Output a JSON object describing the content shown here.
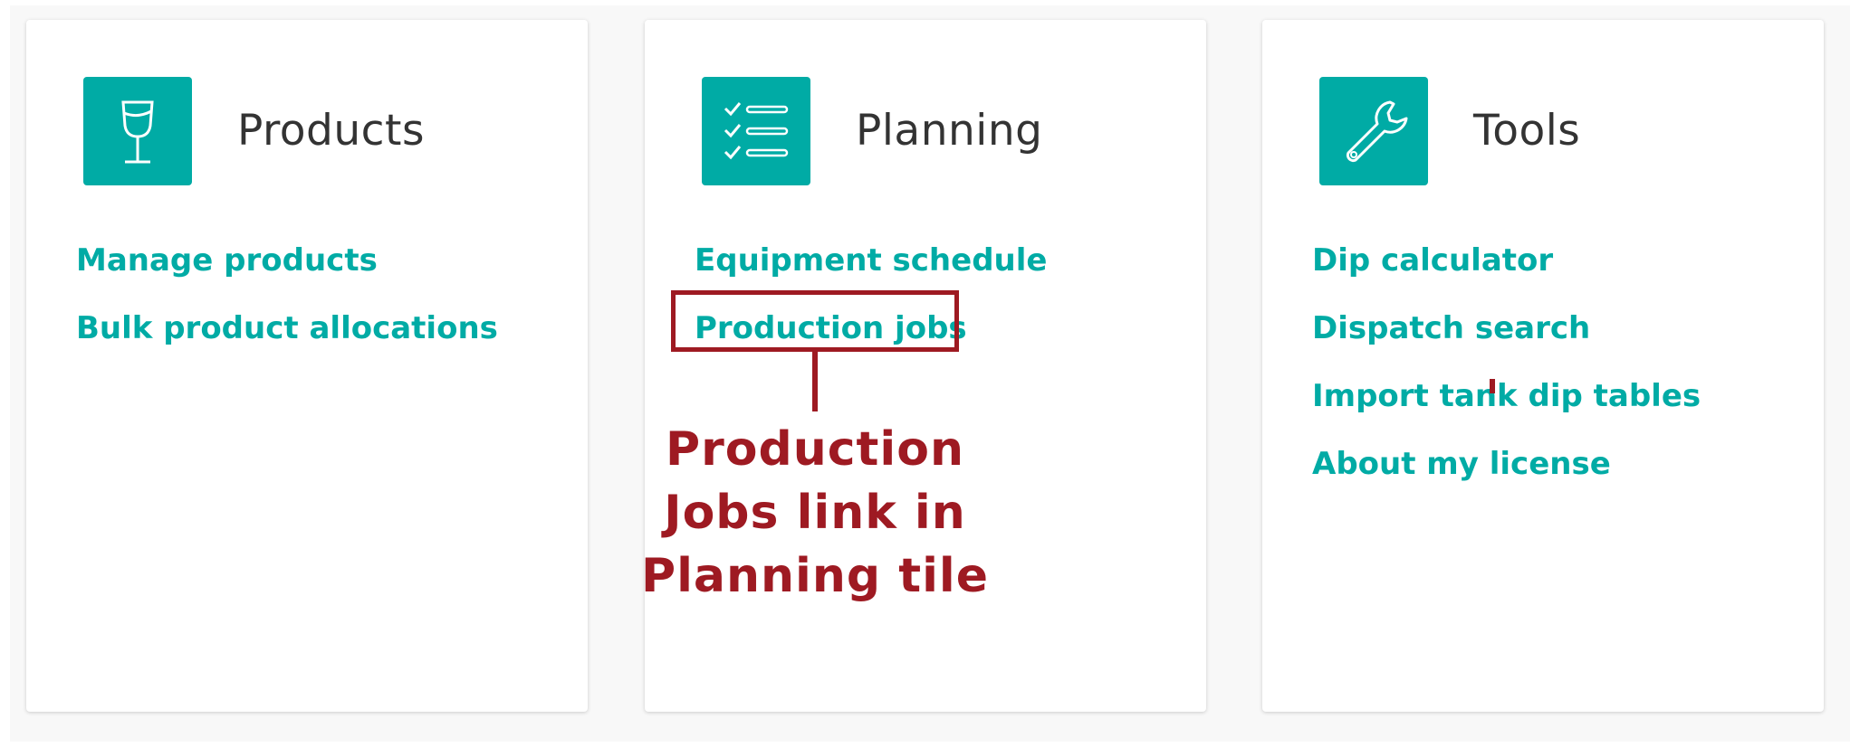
{
  "tiles": {
    "products": {
      "icon": "wine-glass-icon",
      "title": "Products",
      "links": [
        "Manage products",
        "Bulk product allocations"
      ]
    },
    "planning": {
      "icon": "checklist-icon",
      "title": "Planning",
      "links": [
        "Equipment schedule",
        "Production jobs"
      ]
    },
    "tools": {
      "icon": "wrench-icon",
      "title": "Tools",
      "links": [
        "Dip calculator",
        "Dispatch search",
        "Import tank dip tables",
        "About my license"
      ]
    }
  },
  "annotation": {
    "lines": [
      "Production",
      "Jobs link in",
      "Planning tile"
    ],
    "color": "#9e1a22"
  },
  "colors": {
    "accent": "#00aba5",
    "annotation": "#9e1a22"
  }
}
